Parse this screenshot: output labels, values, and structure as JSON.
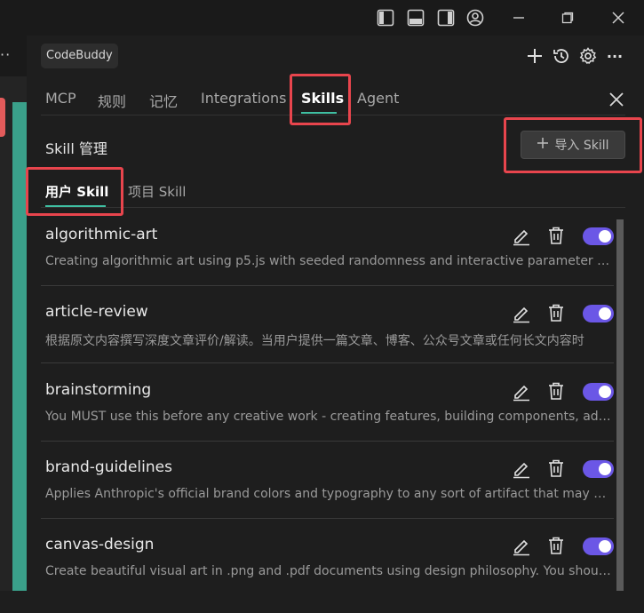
{
  "app": {
    "badge": "CodeBuddy"
  },
  "tabs": [
    {
      "label": "MCP"
    },
    {
      "label": "规则"
    },
    {
      "label": "记忆"
    },
    {
      "label": "Integrations"
    },
    {
      "label": "Skills",
      "active": true
    },
    {
      "label": "Agent"
    }
  ],
  "section": {
    "title": "Skill 管理",
    "import_label": "导入 Skill"
  },
  "subtabs": [
    {
      "label": "用户 Skill",
      "active": true
    },
    {
      "label": "项目 Skill"
    }
  ],
  "skills": [
    {
      "name": "algorithmic-art",
      "desc": "Creating algorithmic art using p5.js with seeded randomness and interactive parameter exploration",
      "enabled": true
    },
    {
      "name": "article-review",
      "desc": "根据原文内容撰写深度文章评价/解读。当用户提供一篇文章、博客、公众号文章或任何长文内容时",
      "enabled": true
    },
    {
      "name": "brainstorming",
      "desc": "You MUST use this before any creative work - creating features, building components, adding functionality",
      "enabled": true
    },
    {
      "name": "brand-guidelines",
      "desc": "Applies Anthropic's official brand colors and typography to any sort of artifact that may benefit",
      "enabled": true
    },
    {
      "name": "canvas-design",
      "desc": "Create beautiful visual art in .png and .pdf documents using design philosophy. You should use this",
      "enabled": true
    }
  ],
  "colors": {
    "accent_underline": "#3fbfa2",
    "toggle_on": "#6b57e6",
    "highlight": "#e8454d"
  },
  "icons": [
    "layout-sidebar-left-icon",
    "layout-panel-icon",
    "layout-sidebar-right-icon",
    "account-icon",
    "minimize-icon",
    "maximize-icon",
    "close-icon",
    "more-icon",
    "plus-icon",
    "history-icon",
    "gear-icon",
    "edit-icon",
    "trash-icon"
  ]
}
